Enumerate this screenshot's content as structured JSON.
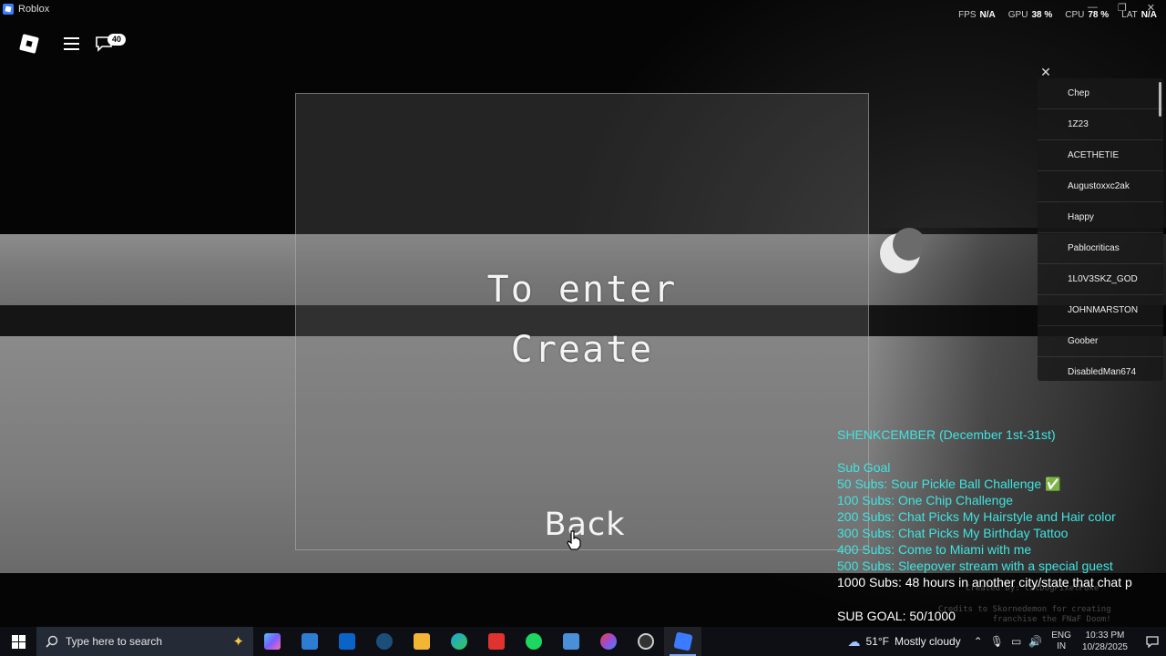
{
  "app": {
    "title": "Roblox"
  },
  "topbar": {
    "chat_badge": "40",
    "stats": [
      {
        "label": "FPS",
        "value": "N/A"
      },
      {
        "label": "GPU",
        "value": "38 %"
      },
      {
        "label": "CPU",
        "value": "78 %"
      },
      {
        "label": "LAT",
        "value": "N/A"
      }
    ]
  },
  "panel": {
    "line1": "To enter",
    "line2": "Create",
    "back_label": "Back"
  },
  "player_list": {
    "players": [
      "Chep",
      "1Z23",
      "ACETHETIE",
      "Augustoxxc2ak",
      "Happy",
      "Pablocriticas",
      "1L0V3SKZ_GOD",
      "JOHNMARSTON",
      "Goober",
      "DisabledMan674"
    ]
  },
  "overlay": {
    "title": "SHENKCEMBER (December 1st-31st)",
    "sub_goal_heading": "Sub Goal",
    "goals": [
      " 50 Subs: Sour Pickle Ball Challenge ✅",
      "100 Subs: One Chip Challenge",
      "200 Subs: Chat Picks My Hairstyle and Hair color",
      "300 Subs: Chat Picks My Birthday Tattoo",
      "400 Subs: Come to Miami with me",
      "500 Subs: Sleepover stream with a special guest",
      "1000 Subs: 48 hours in another city/state that chat p"
    ],
    "sub_count": "SUB GOAL: 50/1000",
    "credits_line1": "Created by: CatDogPixelPuke",
    "credits_line2": "Credits to Skornedemon for creating",
    "credits_line3": "franchise the FNaF Doom!"
  },
  "taskbar": {
    "search_placeholder": "Type here to search",
    "weather_temp": "51°F",
    "weather_text": "Mostly cloudy",
    "lang_top": "ENG",
    "lang_bottom": "IN",
    "time": "10:33 PM",
    "date": "10/28/2025",
    "apps": [
      {
        "name": "copilot-icon",
        "color": "#7b5cff"
      },
      {
        "name": "store-icon",
        "color": "#2d7dd2"
      },
      {
        "name": "outlook-icon",
        "color": "#0a64c8"
      },
      {
        "name": "steam-icon",
        "color": "#1b4f7a"
      },
      {
        "name": "file-explorer-icon",
        "color": "#f2b634"
      },
      {
        "name": "edge-icon",
        "color": "#1fa3d8"
      },
      {
        "name": "wps-icon",
        "color": "#e0322f"
      },
      {
        "name": "spotify-icon",
        "color": "#1ed760"
      },
      {
        "name": "window-app-icon",
        "color": "#4a90d9"
      },
      {
        "name": "chrome-icon",
        "color": "#9b4bd6"
      },
      {
        "name": "recorder-icon",
        "color": "#d33a3a"
      },
      {
        "name": "roblox-icon",
        "color": "#ffffff"
      }
    ]
  }
}
